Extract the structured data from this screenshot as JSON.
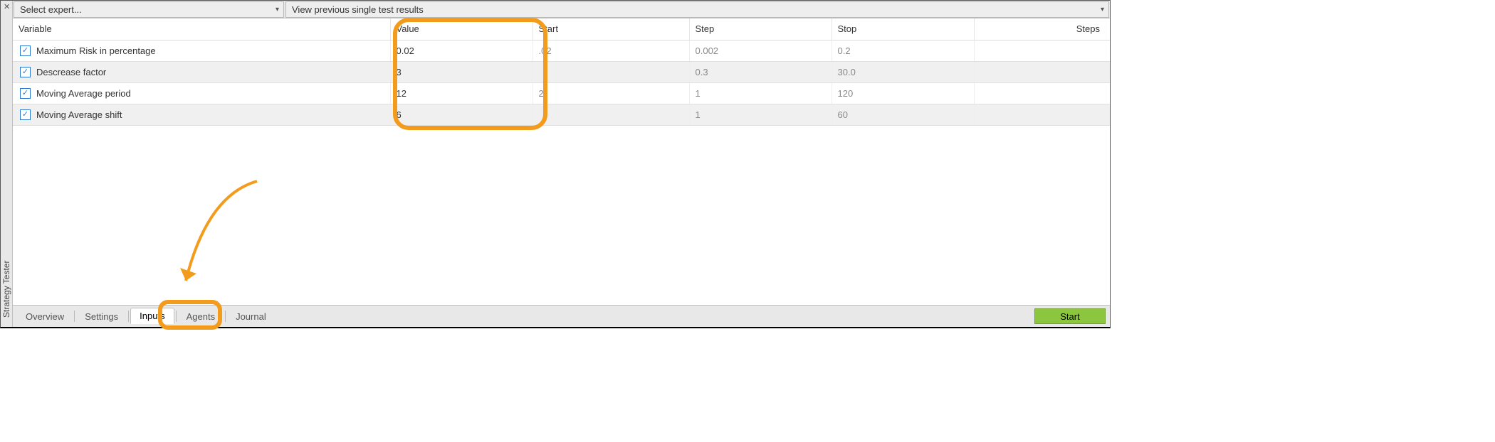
{
  "panel_title": "Strategy Tester",
  "toolbar": {
    "expert_dropdown": "Select expert...",
    "results_dropdown": "View previous single test results"
  },
  "columns": {
    "variable": "Variable",
    "value": "Value",
    "start": "Start",
    "step": "Step",
    "stop": "Stop",
    "steps": "Steps"
  },
  "rows": [
    {
      "checked": true,
      "variable": "Maximum Risk in percentage",
      "value": "0.02",
      "start": "0.02",
      "step": "0.002",
      "stop": "0.2",
      "steps": "",
      "alt": false,
      "start_clip": ".02"
    },
    {
      "checked": true,
      "variable": "Descrease factor",
      "value": "3",
      "start": "",
      "step": "0.3",
      "stop": "30.0",
      "steps": "",
      "alt": true,
      "start_clip": ""
    },
    {
      "checked": true,
      "variable": "Moving Average period",
      "value": "12",
      "start": "12",
      "step": "1",
      "stop": "120",
      "steps": "",
      "alt": false,
      "start_clip": "2"
    },
    {
      "checked": true,
      "variable": "Moving Average shift",
      "value": "6",
      "start": "",
      "step": "1",
      "stop": "60",
      "steps": "",
      "alt": true,
      "start_clip": ""
    }
  ],
  "tabs": {
    "overview": "Overview",
    "settings": "Settings",
    "inputs": "Inputs",
    "agents": "Agents",
    "journal": "Journal",
    "active": "inputs"
  },
  "start_button": "Start",
  "highlight_color": "#f29b1d",
  "start_button_color": "#8cc63f"
}
